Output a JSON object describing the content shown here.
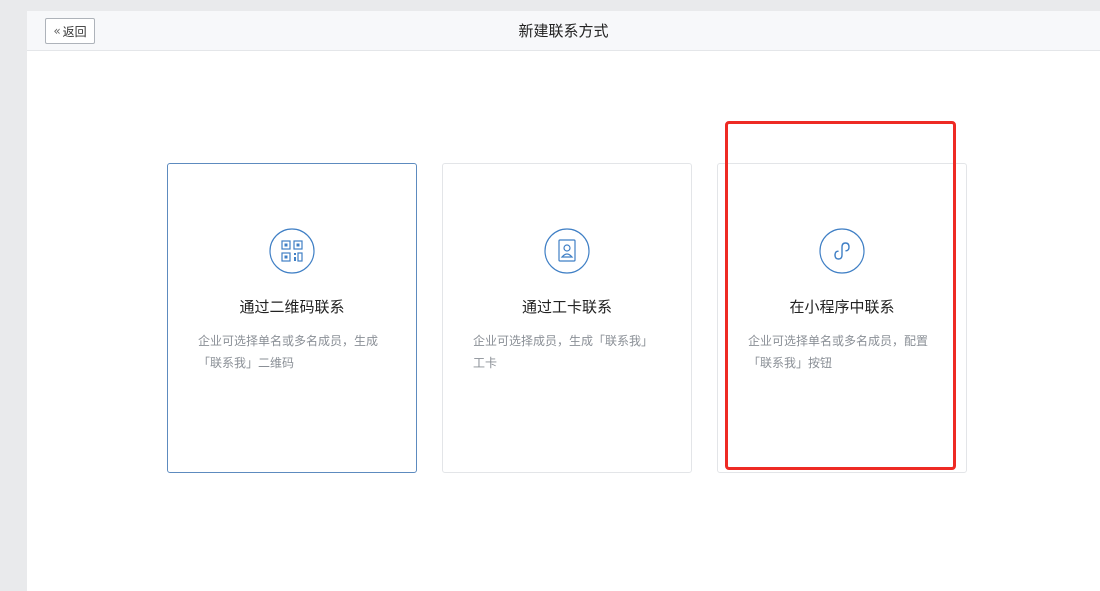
{
  "header": {
    "back_label": "返回",
    "title": "新建联系方式"
  },
  "cards": [
    {
      "title": "通过二维码联系",
      "desc_line1": "企业可选择单名或多名成员，生成",
      "desc_line2": "「联系我」二维码",
      "icon": "qr-code-icon",
      "selected": true
    },
    {
      "title": "通过工卡联系",
      "desc_line1": "企业可选择成员，生成「联系我」",
      "desc_line2": "工卡",
      "icon": "badge-card-icon",
      "selected": false
    },
    {
      "title": "在小程序中联系",
      "desc_line1": "企业可选择单名或多名成员，配置",
      "desc_line2": "「联系我」按钮",
      "icon": "mini-program-icon",
      "selected": false
    }
  ],
  "colors": {
    "accent": "#3f7fc5",
    "selected_border": "#5d8bbf",
    "annotation": "#ee2a24"
  }
}
